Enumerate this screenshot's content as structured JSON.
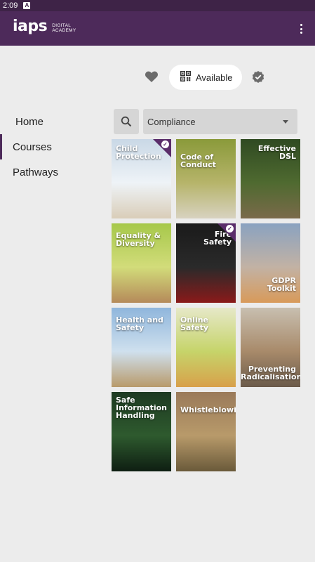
{
  "status_bar": {
    "time": "2:09",
    "badge": "A"
  },
  "app_bar": {
    "logo_word": "iaps",
    "logo_sub_line1": "DIGITAL",
    "logo_sub_line2": "ACADEMY"
  },
  "filters": {
    "available_label": "Available"
  },
  "nav": {
    "items": [
      {
        "label": "Home"
      },
      {
        "label": "Courses"
      },
      {
        "label": "Pathways"
      }
    ],
    "active": "Courses"
  },
  "category_select": {
    "value": "Compliance"
  },
  "courses": [
    {
      "title": "Child\nProtection",
      "completed": true,
      "colors": [
        "#c9d8e6",
        "#eef3f7",
        "#d9cdb8"
      ]
    },
    {
      "title": "Code of\nConduct",
      "completed": false,
      "colors": [
        "#8a9a3a",
        "#b6b46a",
        "#d8d2c0"
      ]
    },
    {
      "title": "Effective\nDSL",
      "completed": false,
      "colors": [
        "#2f4a22",
        "#4f6a30",
        "#7a6a4a"
      ]
    },
    {
      "title": "Equality &\nDiversity",
      "completed": false,
      "colors": [
        "#a6c84a",
        "#d2dc7a",
        "#b58a5a"
      ]
    },
    {
      "title": "Fire\nSafety",
      "completed": true,
      "colors": [
        "#1a1a1a",
        "#2a2a2a",
        "#8a1a1a"
      ]
    },
    {
      "title": "GDPR\nToolkit",
      "completed": false,
      "colors": [
        "#8aa2c0",
        "#c2b2a4",
        "#d89a5a"
      ]
    },
    {
      "title": "Health and\nSafety",
      "completed": false,
      "colors": [
        "#8fb6dc",
        "#cfe0ee",
        "#b89a6a"
      ]
    },
    {
      "title": "Online\nSafety",
      "completed": false,
      "colors": [
        "#e6e8c8",
        "#c6d46a",
        "#d8a04a"
      ]
    },
    {
      "title": "Preventing\nRadicalisation",
      "completed": false,
      "colors": [
        "#c8bfb0",
        "#a88a6a",
        "#6a5a4a"
      ]
    },
    {
      "title": "Safe\nInformation\nHandling",
      "completed": false,
      "colors": [
        "#1e3a22",
        "#2e5a2e",
        "#0e1e12"
      ]
    },
    {
      "title": "Whistleblowing",
      "completed": false,
      "colors": [
        "#9a7a5a",
        "#b89a6a",
        "#6a5a3a"
      ]
    }
  ],
  "theme": {
    "primary": "#4d2a5a",
    "status_bar": "#3e2347",
    "background": "#ececec"
  }
}
